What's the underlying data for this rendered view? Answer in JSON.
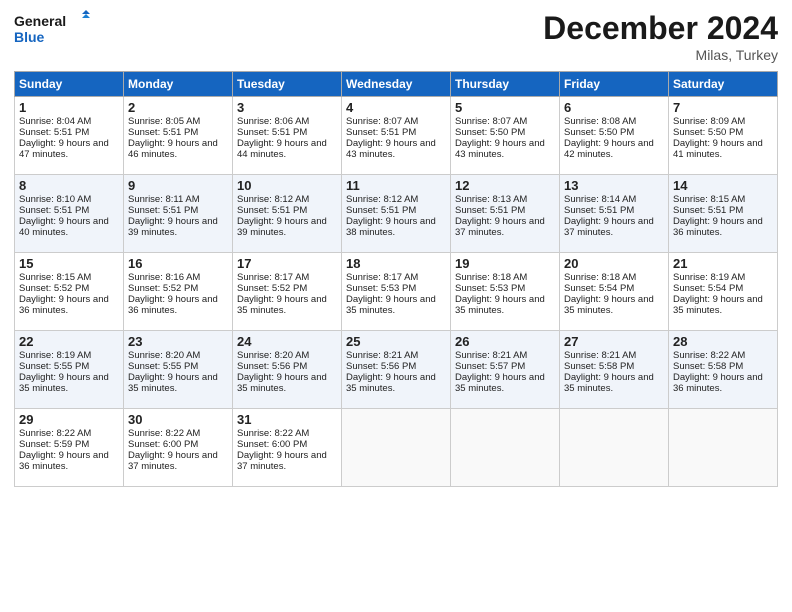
{
  "header": {
    "logo_line1": "General",
    "logo_line2": "Blue",
    "title": "December 2024",
    "location": "Milas, Turkey"
  },
  "days_of_week": [
    "Sunday",
    "Monday",
    "Tuesday",
    "Wednesday",
    "Thursday",
    "Friday",
    "Saturday"
  ],
  "weeks": [
    [
      {
        "day": "1",
        "sunrise": "Sunrise: 8:04 AM",
        "sunset": "Sunset: 5:51 PM",
        "daylight": "Daylight: 9 hours and 47 minutes."
      },
      {
        "day": "2",
        "sunrise": "Sunrise: 8:05 AM",
        "sunset": "Sunset: 5:51 PM",
        "daylight": "Daylight: 9 hours and 46 minutes."
      },
      {
        "day": "3",
        "sunrise": "Sunrise: 8:06 AM",
        "sunset": "Sunset: 5:51 PM",
        "daylight": "Daylight: 9 hours and 44 minutes."
      },
      {
        "day": "4",
        "sunrise": "Sunrise: 8:07 AM",
        "sunset": "Sunset: 5:51 PM",
        "daylight": "Daylight: 9 hours and 43 minutes."
      },
      {
        "day": "5",
        "sunrise": "Sunrise: 8:07 AM",
        "sunset": "Sunset: 5:50 PM",
        "daylight": "Daylight: 9 hours and 43 minutes."
      },
      {
        "day": "6",
        "sunrise": "Sunrise: 8:08 AM",
        "sunset": "Sunset: 5:50 PM",
        "daylight": "Daylight: 9 hours and 42 minutes."
      },
      {
        "day": "7",
        "sunrise": "Sunrise: 8:09 AM",
        "sunset": "Sunset: 5:50 PM",
        "daylight": "Daylight: 9 hours and 41 minutes."
      }
    ],
    [
      {
        "day": "8",
        "sunrise": "Sunrise: 8:10 AM",
        "sunset": "Sunset: 5:51 PM",
        "daylight": "Daylight: 9 hours and 40 minutes."
      },
      {
        "day": "9",
        "sunrise": "Sunrise: 8:11 AM",
        "sunset": "Sunset: 5:51 PM",
        "daylight": "Daylight: 9 hours and 39 minutes."
      },
      {
        "day": "10",
        "sunrise": "Sunrise: 8:12 AM",
        "sunset": "Sunset: 5:51 PM",
        "daylight": "Daylight: 9 hours and 39 minutes."
      },
      {
        "day": "11",
        "sunrise": "Sunrise: 8:12 AM",
        "sunset": "Sunset: 5:51 PM",
        "daylight": "Daylight: 9 hours and 38 minutes."
      },
      {
        "day": "12",
        "sunrise": "Sunrise: 8:13 AM",
        "sunset": "Sunset: 5:51 PM",
        "daylight": "Daylight: 9 hours and 37 minutes."
      },
      {
        "day": "13",
        "sunrise": "Sunrise: 8:14 AM",
        "sunset": "Sunset: 5:51 PM",
        "daylight": "Daylight: 9 hours and 37 minutes."
      },
      {
        "day": "14",
        "sunrise": "Sunrise: 8:15 AM",
        "sunset": "Sunset: 5:51 PM",
        "daylight": "Daylight: 9 hours and 36 minutes."
      }
    ],
    [
      {
        "day": "15",
        "sunrise": "Sunrise: 8:15 AM",
        "sunset": "Sunset: 5:52 PM",
        "daylight": "Daylight: 9 hours and 36 minutes."
      },
      {
        "day": "16",
        "sunrise": "Sunrise: 8:16 AM",
        "sunset": "Sunset: 5:52 PM",
        "daylight": "Daylight: 9 hours and 36 minutes."
      },
      {
        "day": "17",
        "sunrise": "Sunrise: 8:17 AM",
        "sunset": "Sunset: 5:52 PM",
        "daylight": "Daylight: 9 hours and 35 minutes."
      },
      {
        "day": "18",
        "sunrise": "Sunrise: 8:17 AM",
        "sunset": "Sunset: 5:53 PM",
        "daylight": "Daylight: 9 hours and 35 minutes."
      },
      {
        "day": "19",
        "sunrise": "Sunrise: 8:18 AM",
        "sunset": "Sunset: 5:53 PM",
        "daylight": "Daylight: 9 hours and 35 minutes."
      },
      {
        "day": "20",
        "sunrise": "Sunrise: 8:18 AM",
        "sunset": "Sunset: 5:54 PM",
        "daylight": "Daylight: 9 hours and 35 minutes."
      },
      {
        "day": "21",
        "sunrise": "Sunrise: 8:19 AM",
        "sunset": "Sunset: 5:54 PM",
        "daylight": "Daylight: 9 hours and 35 minutes."
      }
    ],
    [
      {
        "day": "22",
        "sunrise": "Sunrise: 8:19 AM",
        "sunset": "Sunset: 5:55 PM",
        "daylight": "Daylight: 9 hours and 35 minutes."
      },
      {
        "day": "23",
        "sunrise": "Sunrise: 8:20 AM",
        "sunset": "Sunset: 5:55 PM",
        "daylight": "Daylight: 9 hours and 35 minutes."
      },
      {
        "day": "24",
        "sunrise": "Sunrise: 8:20 AM",
        "sunset": "Sunset: 5:56 PM",
        "daylight": "Daylight: 9 hours and 35 minutes."
      },
      {
        "day": "25",
        "sunrise": "Sunrise: 8:21 AM",
        "sunset": "Sunset: 5:56 PM",
        "daylight": "Daylight: 9 hours and 35 minutes."
      },
      {
        "day": "26",
        "sunrise": "Sunrise: 8:21 AM",
        "sunset": "Sunset: 5:57 PM",
        "daylight": "Daylight: 9 hours and 35 minutes."
      },
      {
        "day": "27",
        "sunrise": "Sunrise: 8:21 AM",
        "sunset": "Sunset: 5:58 PM",
        "daylight": "Daylight: 9 hours and 35 minutes."
      },
      {
        "day": "28",
        "sunrise": "Sunrise: 8:22 AM",
        "sunset": "Sunset: 5:58 PM",
        "daylight": "Daylight: 9 hours and 36 minutes."
      }
    ],
    [
      {
        "day": "29",
        "sunrise": "Sunrise: 8:22 AM",
        "sunset": "Sunset: 5:59 PM",
        "daylight": "Daylight: 9 hours and 36 minutes."
      },
      {
        "day": "30",
        "sunrise": "Sunrise: 8:22 AM",
        "sunset": "Sunset: 6:00 PM",
        "daylight": "Daylight: 9 hours and 37 minutes."
      },
      {
        "day": "31",
        "sunrise": "Sunrise: 8:22 AM",
        "sunset": "Sunset: 6:00 PM",
        "daylight": "Daylight: 9 hours and 37 minutes."
      },
      null,
      null,
      null,
      null
    ]
  ]
}
